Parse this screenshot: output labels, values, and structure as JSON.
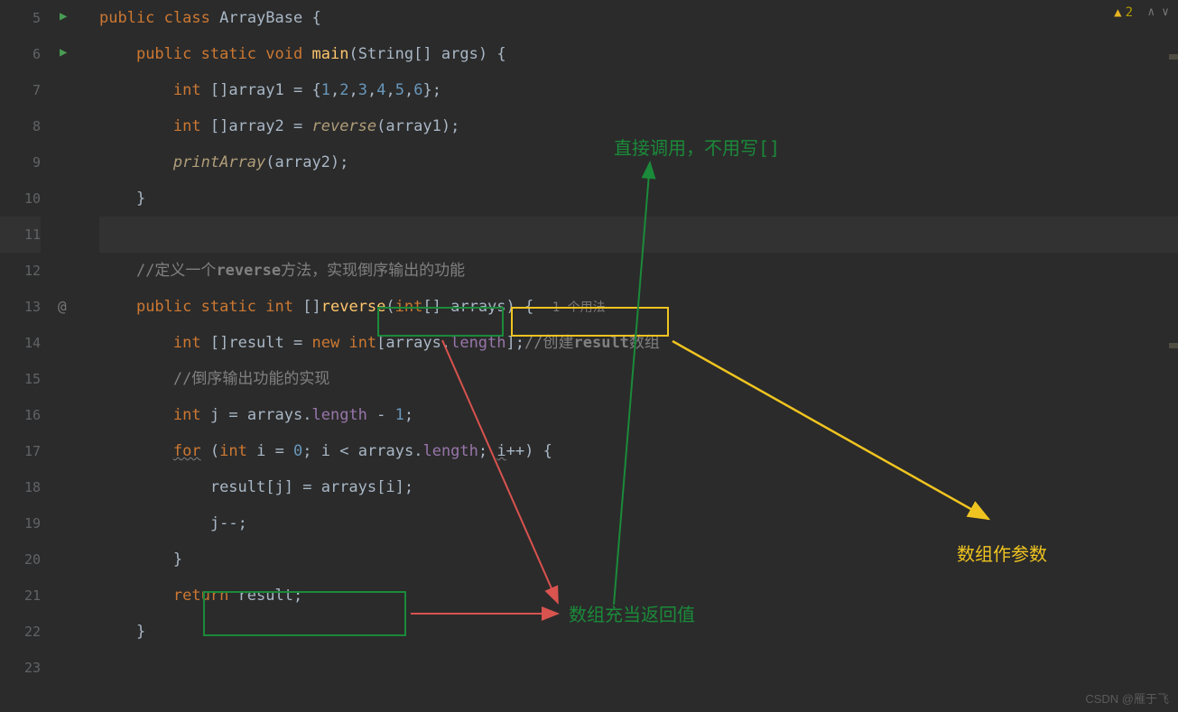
{
  "warnings": {
    "count": "2"
  },
  "usage_hint": "1 个用法",
  "watermark": "CSDN @雁于飞",
  "annotations": {
    "green1": "直接调用，不用写[]",
    "green2": "数组充当返回值",
    "yellow1": "数组作参数"
  },
  "gutter": {
    "lines": [
      "5",
      "6",
      "7",
      "8",
      "9",
      "10",
      "11",
      "12",
      "13",
      "14",
      "15",
      "16",
      "17",
      "18",
      "19",
      "20",
      "21",
      "22",
      "23"
    ]
  },
  "code": {
    "l5": {
      "kw1": "public",
      "kw2": "class",
      "cls": "ArrayBase",
      "brace": "{"
    },
    "l6": {
      "kw1": "public",
      "kw2": "static",
      "kw3": "void",
      "m": "main",
      "p1": "(",
      "t": "String",
      "br": "[]",
      "sp": " ",
      "arg": "args",
      "p2": ")",
      "sp2": " ",
      "brace": "{"
    },
    "l7": {
      "t": "int",
      "br": "[]",
      "v": "array1",
      "eq": " = ",
      "ob": "{",
      "n1": "1",
      "c1": ",",
      "n2": "2",
      "c2": ",",
      "n3": "3",
      "c3": ",",
      "n4": "4",
      "c4": ",",
      "n5": "5",
      "c5": ",",
      "n6": "6",
      "cb": "}",
      "sc": ";"
    },
    "l8": {
      "t": "int",
      "br": "[]",
      "v": "array2",
      "eq": " = ",
      "m": "reverse",
      "p1": "(",
      "arg": "array1",
      "p2": ")",
      "sc": ";"
    },
    "l9": {
      "m": "printArray",
      "p1": "(",
      "arg": "array2",
      "p2": ")",
      "sc": ";"
    },
    "l10": {
      "brace": "}"
    },
    "l12": {
      "c": "//定义一个",
      "kw": "reverse",
      "c2": "方法，实现倒序输出的功能"
    },
    "l13": {
      "kw1": "public",
      "kw2": "static",
      "t": "int",
      "br": "[]",
      "m": "reverse",
      "p1": "(",
      "t2": "int",
      "br2": "[]",
      "sp": " ",
      "arg": "arrays",
      "p2": ")",
      "sp2": " ",
      "brace": "{"
    },
    "l14": {
      "t": "int",
      "br": "[]",
      "v": "result",
      "eq": " = ",
      "kw": "new",
      "sp": " ",
      "t2": "int",
      "ob": "[",
      "arg": "arrays",
      "dot": ".",
      "f": "length",
      "cb": "]",
      "sc": ";",
      "c": "//创建",
      "kw2": "result",
      "c2": "数组"
    },
    "l15": {
      "c": "//倒序输出功能的实现"
    },
    "l16": {
      "t": "int",
      "sp": " ",
      "v": "j",
      "eq": " = ",
      "arg": "arrays",
      "dot": ".",
      "f": "length",
      "sp2": " ",
      "op": "-",
      "sp3": " ",
      "n": "1",
      "sc": ";"
    },
    "l17": {
      "kw": "for",
      "sp": " ",
      "p1": "(",
      "t": "int",
      "sp2": " ",
      "v": "i",
      "eq": " = ",
      "n": "0",
      "sc1": ";",
      "sp3": " ",
      "v2": "i",
      "sp4": " ",
      "op": "<",
      "sp5": " ",
      "arg": "arrays",
      "dot": ".",
      "f": "length",
      "sc2": ";",
      "sp6": " ",
      "v3": "i",
      "op2": "++",
      "p2": ")",
      "sp7": " ",
      "brace": "{"
    },
    "l18": {
      "v": "result",
      "ob": "[",
      "v2": "j",
      "cb": "]",
      "eq": " = ",
      "arg": "arrays",
      "ob2": "[",
      "v3": "i",
      "cb2": "]",
      "sc": ";"
    },
    "l19": {
      "v": "j",
      "op": "--",
      "sc": ";"
    },
    "l20": {
      "brace": "}"
    },
    "l21": {
      "kw": "return",
      "sp": " ",
      "v": "result",
      "sc": ";"
    },
    "l22": {
      "brace": "}"
    }
  }
}
